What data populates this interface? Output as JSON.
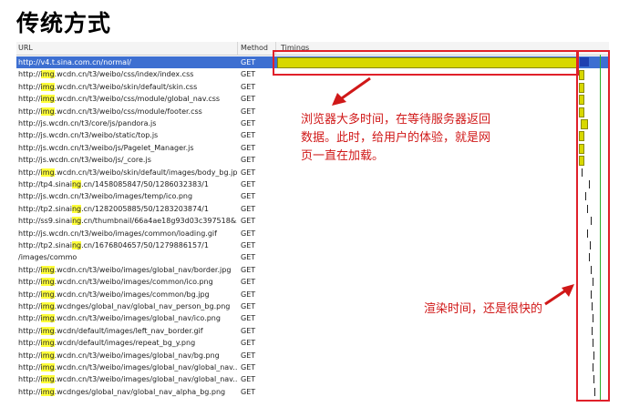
{
  "title": "传统方式",
  "columns": {
    "url": "URL",
    "method": "Method",
    "timings": "Timings"
  },
  "rows": [
    {
      "pre": "http://v4.t.sina.com.cn/normal/",
      "hl": "",
      "post": "",
      "method": "GET",
      "selected": true
    },
    {
      "pre": "http://",
      "hl": "img",
      "post": ".wcdn.cn/t3/weibo/css/index/index.css",
      "method": "GET"
    },
    {
      "pre": "http://",
      "hl": "img",
      "post": ".wcdn.cn/t3/weibo/skin/default/skin.css",
      "method": "GET"
    },
    {
      "pre": "http://",
      "hl": "img",
      "post": ".wcdn.cn/t3/weibo/css/module/global_nav.css",
      "method": "GET"
    },
    {
      "pre": "http://",
      "hl": "img",
      "post": ".wcdn.cn/t3/weibo/css/module/footer.css",
      "method": "GET"
    },
    {
      "pre": "http://js.wcdn.cn/t3/core/js/pandora.js",
      "hl": "",
      "post": "",
      "method": "GET"
    },
    {
      "pre": "http://js.wcdn.cn/t3/weibo/static/top.js",
      "hl": "",
      "post": "",
      "method": "GET"
    },
    {
      "pre": "http://js.wcdn.cn/t3/weibo/js/Pagelet_Manager.js",
      "hl": "",
      "post": "",
      "method": "GET"
    },
    {
      "pre": "http://js.wcdn.cn/t3/weibo/js/_core.js",
      "hl": "",
      "post": "",
      "method": "GET"
    },
    {
      "pre": "http://",
      "hl": "img",
      "post": ".wcdn.cn/t3/weibo/skin/default/images/body_bg.jpg",
      "method": "GET"
    },
    {
      "pre": "http://tp4.sinai",
      "hl": "ng",
      "post": ".cn/1458085847/50/1286032383/1",
      "method": "GET"
    },
    {
      "pre": "http://js.wcdn.cn/t3/weibo/images/temp/ico.png",
      "hl": "",
      "post": "",
      "method": "GET"
    },
    {
      "pre": "http://tp2.sinai",
      "hl": "ng",
      "post": ".cn/1282005885/50/1283203874/1",
      "method": "GET"
    },
    {
      "pre": "http://ss9.sinai",
      "hl": "ng",
      "post": ".cn/thumbnail/66a4ae18g93d03c397518&...",
      "method": "GET"
    },
    {
      "pre": "http://js.wcdn.cn/t3/weibo/images/common/loading.gif",
      "hl": "",
      "post": "",
      "method": "GET"
    },
    {
      "pre": "http://tp2.sinai",
      "hl": "ng",
      "post": ".cn/1676804657/50/1279886157/1",
      "method": "GET"
    },
    {
      "pre": "/images/commo",
      "hl": "",
      "post": "",
      "method": "GET"
    },
    {
      "pre": "http://",
      "hl": "img",
      "post": ".wcdn.cn/t3/weibo/images/global_nav/border.jpg",
      "method": "GET"
    },
    {
      "pre": "http://",
      "hl": "img",
      "post": ".wcdn.cn/t3/weibo/images/common/ico.png",
      "method": "GET"
    },
    {
      "pre": "http://",
      "hl": "img",
      "post": ".wcdn.cn/t3/weibo/images/common/bg.jpg",
      "method": "GET"
    },
    {
      "pre": "http://",
      "hl": "img",
      "post": ".wcdnges/global_nav/global_nav_person_bg.png",
      "method": "GET"
    },
    {
      "pre": "http://",
      "hl": "img",
      "post": ".wcdn.cn/t3/weibo/images/global_nav/ico.png",
      "method": "GET"
    },
    {
      "pre": "http://",
      "hl": "img",
      "post": ".wcdn/default/images/left_nav_border.gif",
      "method": "GET"
    },
    {
      "pre": "http://",
      "hl": "img",
      "post": ".wcdn/default/images/repeat_bg_y.png",
      "method": "GET"
    },
    {
      "pre": "http://",
      "hl": "img",
      "post": ".wcdn.cn/t3/weibo/images/global_nav/bg.png",
      "method": "GET"
    },
    {
      "pre": "http://",
      "hl": "img",
      "post": ".wcdn.cn/t3/weibo/images/global_nav/global_nav...",
      "method": "GET"
    },
    {
      "pre": "http://",
      "hl": "img",
      "post": ".wcdn.cn/t3/weibo/images/global_nav/global_nav...",
      "method": "GET"
    },
    {
      "pre": "http://",
      "hl": "img",
      "post": ".wcdnges/global_nav/global_nav_alpha_bg.png",
      "method": "GET"
    }
  ],
  "annotations": {
    "server_wait": [
      "浏览器大多时间，在等待服务器返回",
      "数据。此时，给用户的体验，就是网",
      "页一直在加载。"
    ],
    "render": "渲染时间，还是很快的"
  },
  "colors": {
    "highlight": "#ffff3a",
    "annotation": "#d01818",
    "selected": "#3d6fd1"
  }
}
